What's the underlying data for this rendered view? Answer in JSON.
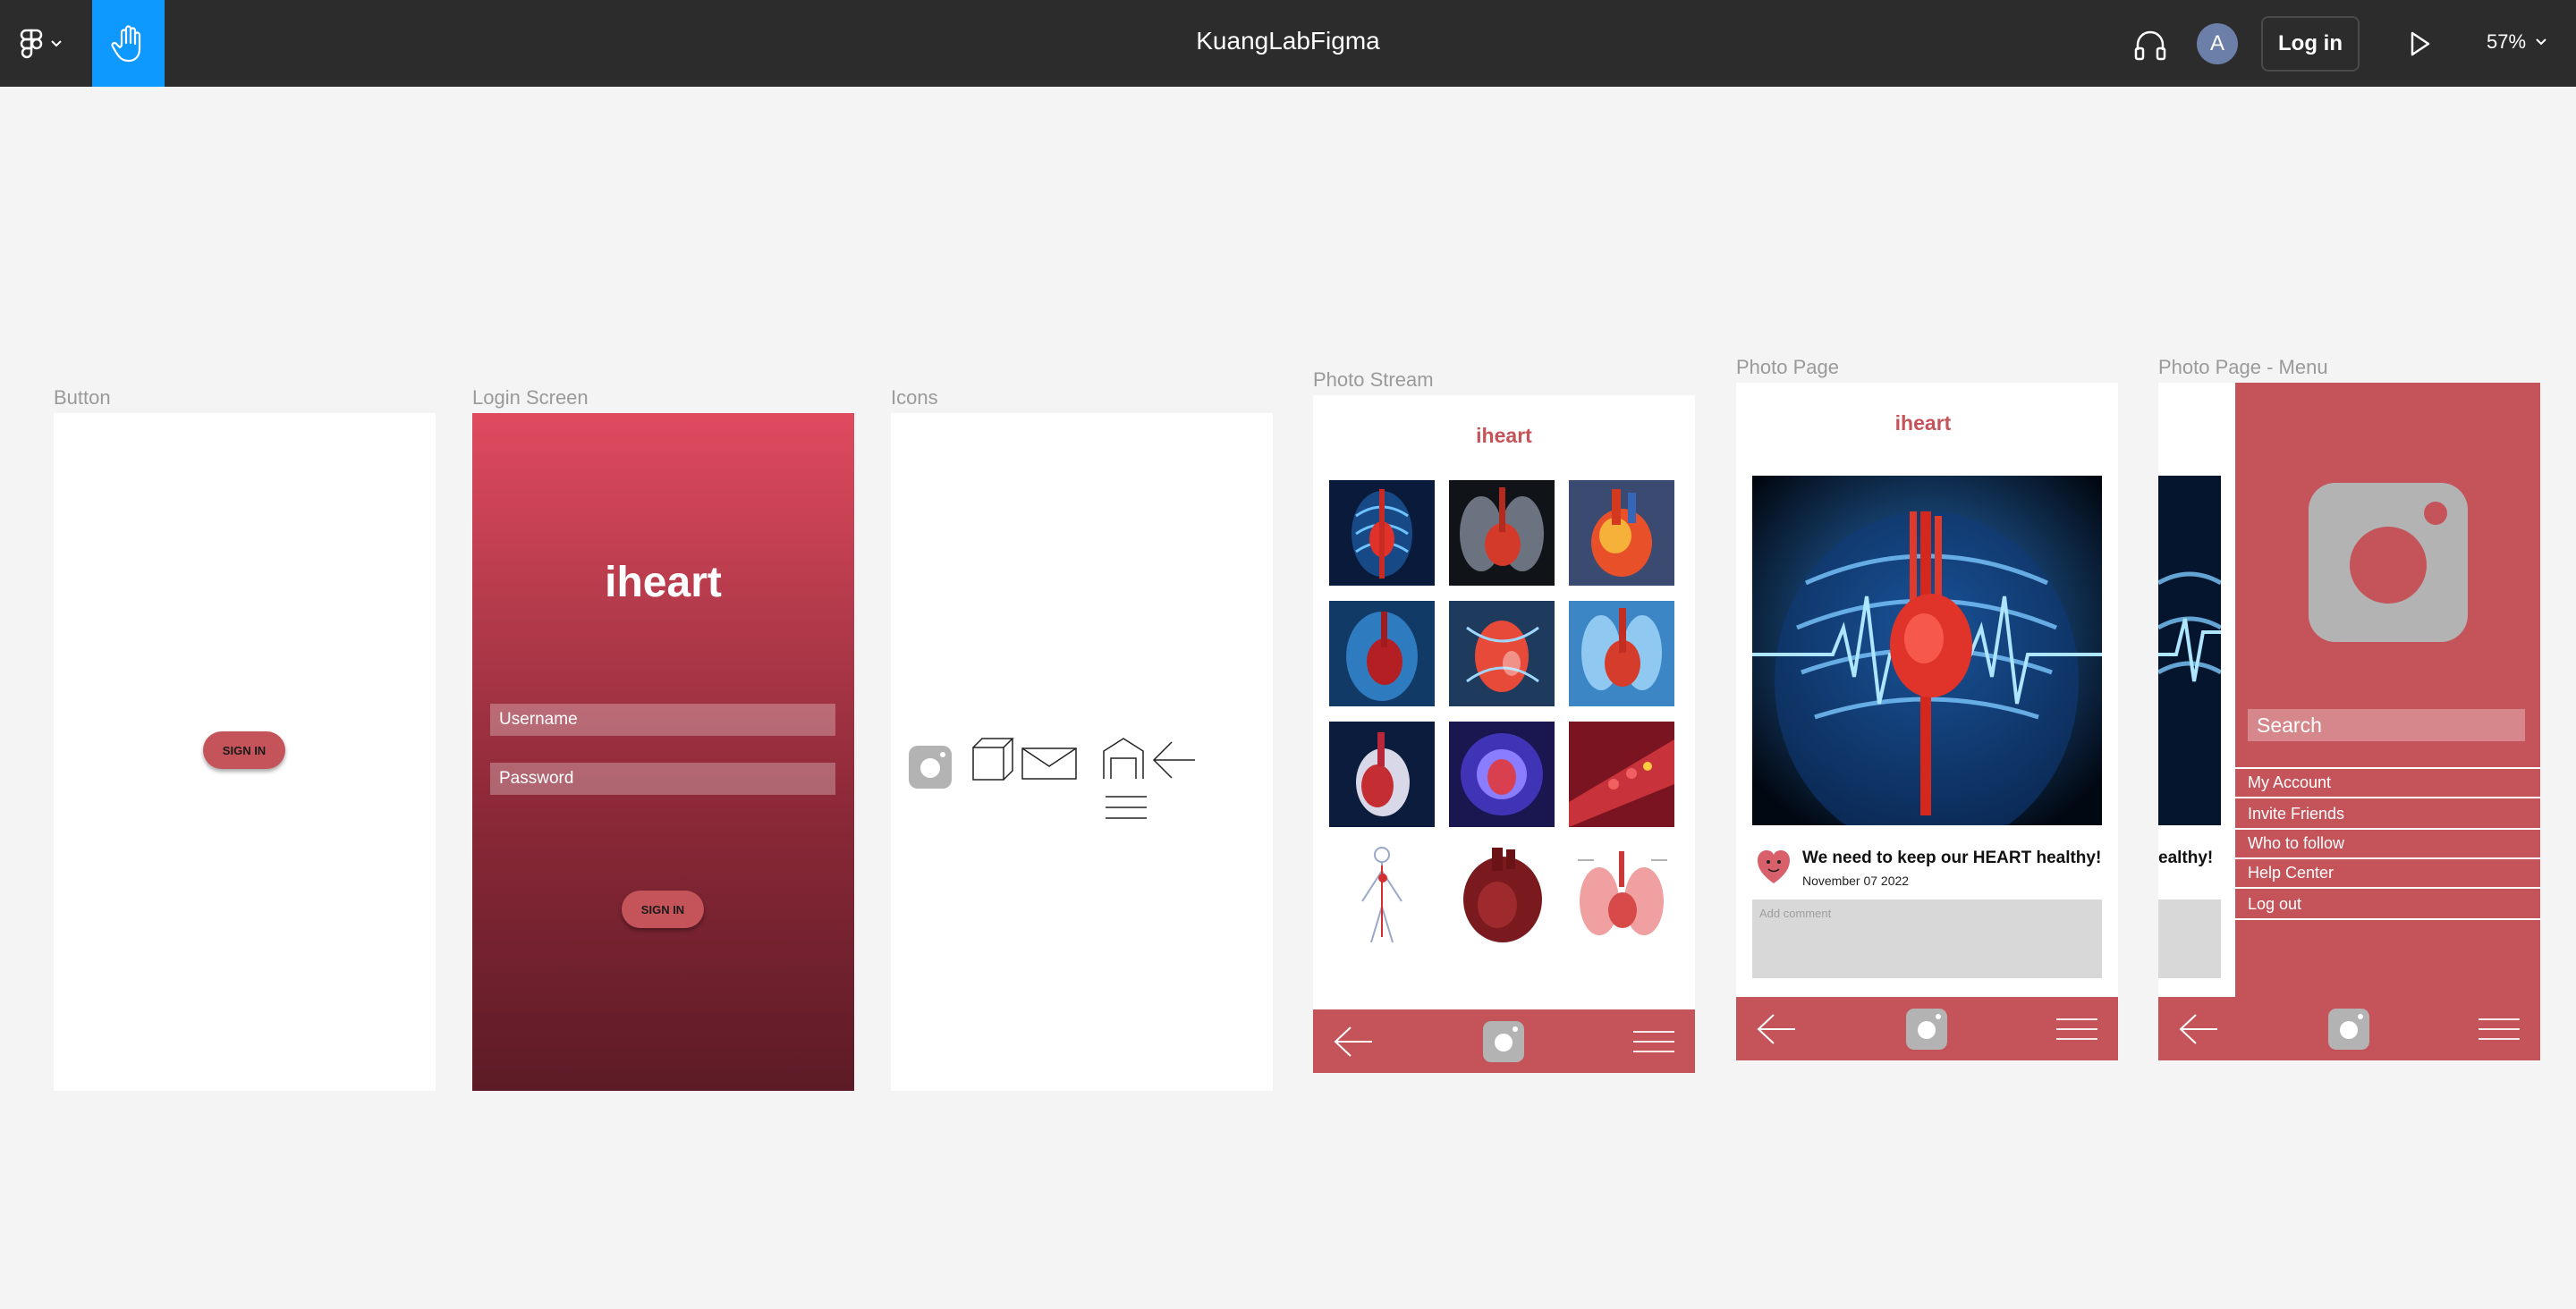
{
  "toolbar": {
    "title": "KuangLabFigma",
    "avatar_initial": "A",
    "login_label": "Log in",
    "zoom": "57%"
  },
  "frames": {
    "button": {
      "label": "Button",
      "button_label": "SIGN IN"
    },
    "login": {
      "label": "Login Screen",
      "logo": "iheart",
      "username_placeholder": "Username",
      "password_placeholder": "Password",
      "button_label": "SIGN IN"
    },
    "icons": {
      "label": "Icons",
      "icon_names": [
        "camera-icon",
        "cube-icon",
        "mail-icon",
        "home-icon",
        "back-arrow-icon",
        "menu-icon"
      ]
    },
    "photo_stream": {
      "label": "Photo Stream",
      "logo": "iheart",
      "thumbnail_count": 12
    },
    "photo_page": {
      "label": "Photo Page",
      "logo": "iheart",
      "post_title": "We need to keep our HEART healthy!",
      "post_date": "November 07 2022",
      "comment_placeholder": "Add comment"
    },
    "photo_page_menu": {
      "label": "Photo Page - Menu",
      "peek_text": "ealthy!",
      "search_placeholder": "Search",
      "menu_items": [
        "My Account",
        "Invite Friends",
        "Who to follow",
        "Help Center",
        "Log out"
      ]
    }
  },
  "colors": {
    "brand_red": "#c4545a",
    "toolbar_bg": "#2c2c2c",
    "tool_active": "#0d99ff",
    "canvas_bg": "#f4f4f4"
  }
}
